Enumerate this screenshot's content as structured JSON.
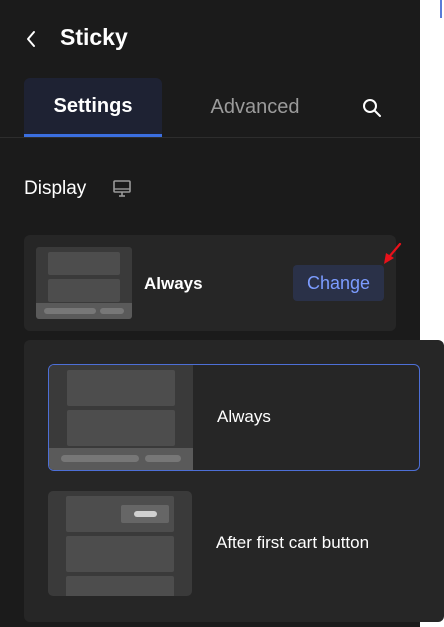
{
  "header": {
    "title": "Sticky",
    "back_icon": "chevron-left-icon"
  },
  "tabs": [
    {
      "label": "Settings",
      "active": true
    },
    {
      "label": "Advanced",
      "active": false
    }
  ],
  "search_icon": "search-icon",
  "display": {
    "title": "Display",
    "icon": "monitor-icon",
    "current_value": "Always",
    "change_label": "Change"
  },
  "dropdown": {
    "options": [
      {
        "label": "Always",
        "selected": true
      },
      {
        "label": "After first cart button",
        "selected": false
      }
    ]
  },
  "colors": {
    "accent": "#3b6fe0",
    "change_text": "#7c9cff",
    "annotation_arrow": "#e8111a"
  }
}
